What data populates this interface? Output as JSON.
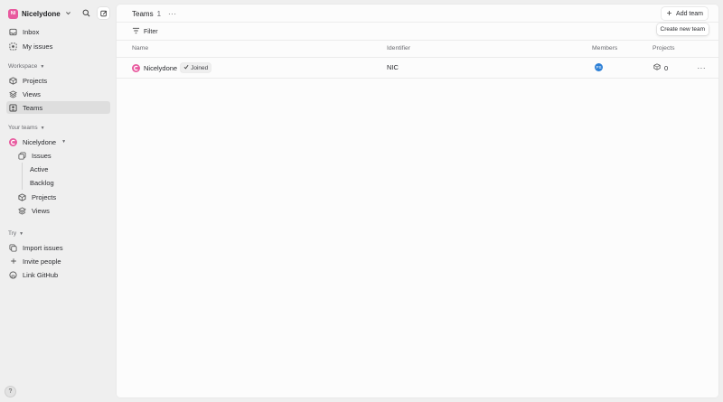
{
  "workspace": {
    "avatar_initials": "NI",
    "name": "Nicelydone"
  },
  "top_nav": [
    {
      "label": "Inbox",
      "icon": "inbox-icon"
    },
    {
      "label": "My issues",
      "icon": "my-issues-icon"
    }
  ],
  "workspace_section": {
    "label": "Workspace",
    "items": [
      {
        "label": "Projects",
        "icon": "projects-icon"
      },
      {
        "label": "Views",
        "icon": "views-icon"
      },
      {
        "label": "Teams",
        "icon": "teams-icon",
        "active": true
      }
    ]
  },
  "teams_section": {
    "label": "Your teams",
    "team": {
      "name": "Nicelydone"
    },
    "children": [
      {
        "label": "Issues"
      },
      {
        "label": "Active"
      },
      {
        "label": "Backlog"
      },
      {
        "label": "Projects"
      },
      {
        "label": "Views"
      }
    ]
  },
  "try_section": {
    "label": "Try",
    "items": [
      {
        "label": "Import issues",
        "icon": "import-icon"
      },
      {
        "label": "Invite people",
        "icon": "plus-icon"
      },
      {
        "label": "Link GitHub",
        "icon": "github-icon"
      }
    ]
  },
  "help": {
    "label": "?"
  },
  "header": {
    "title": "Teams",
    "count": "1",
    "more": "···",
    "add_team": "Add team",
    "tooltip": "Create new team"
  },
  "filter": {
    "label": "Filter"
  },
  "columns": {
    "name": "Name",
    "identifier": "Identifier",
    "members": "Members",
    "projects": "Projects"
  },
  "rows": [
    {
      "name": "Nicelydone",
      "badge": "Joined",
      "identifier": "NIC",
      "member_initials": "PS",
      "projects": "0",
      "more": "···"
    }
  ],
  "colors": {
    "accent": "#e85a9f",
    "member": "#2c7fd6",
    "active_bg": "#dedede"
  }
}
